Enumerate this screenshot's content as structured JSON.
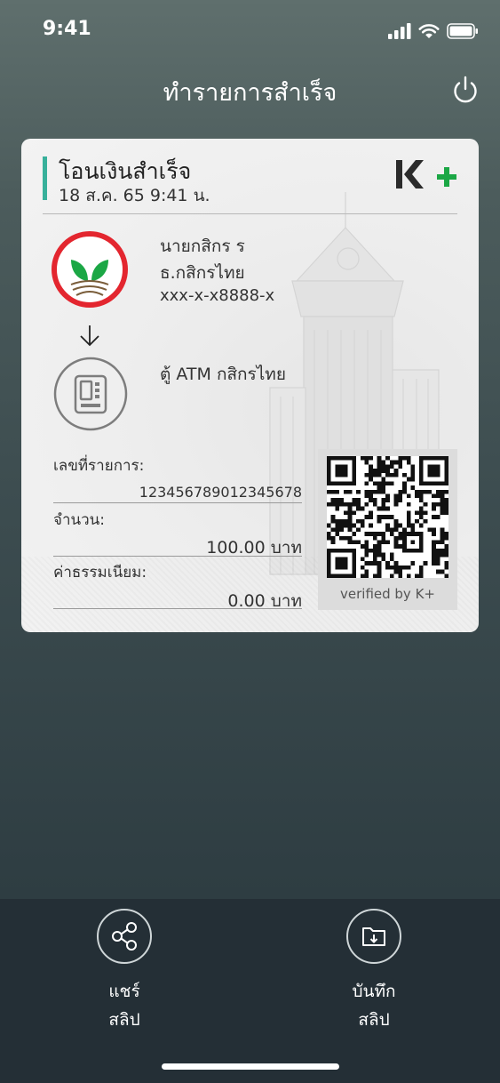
{
  "status_bar": {
    "time": "9:41"
  },
  "header": {
    "title": "ทำรายการสำเร็จ"
  },
  "slip": {
    "title": "โอนเงินสำเร็จ",
    "date": "18 ส.ค. 65  9:41 น.",
    "brand_logo_text": "K+",
    "sender": {
      "name": "นายกสิกร ร",
      "bank": "ธ.กสิกรไทย",
      "account": "xxx-x-x8888-x"
    },
    "receiver": {
      "name": "ตู้ ATM กสิกรไทย"
    },
    "fields": {
      "reference_label": "เลขที่รายการ:",
      "reference_value": "12345678901234567​8",
      "amount_label": "จำนวน:",
      "amount_value": "100.00 บาท",
      "fee_label": "ค่าธรรมเนียม:",
      "fee_value": "0.00 บาท"
    },
    "qr_caption": "verified by K+"
  },
  "actions": {
    "share_label_line1": "แชร์",
    "share_label_line2": "สลิป",
    "save_label_line1": "บันทึก",
    "save_label_line2": "สลิป"
  },
  "colors": {
    "accent": "#38b09b",
    "brand_green": "#1ba745",
    "kbank_red": "#e3262f",
    "bottom_bar": "#242f36"
  },
  "icons": [
    "power-icon",
    "kplus-logo",
    "kasikorn-logo",
    "down-arrow-icon",
    "atm-icon",
    "share-icon",
    "save-icon",
    "qr-code"
  ]
}
